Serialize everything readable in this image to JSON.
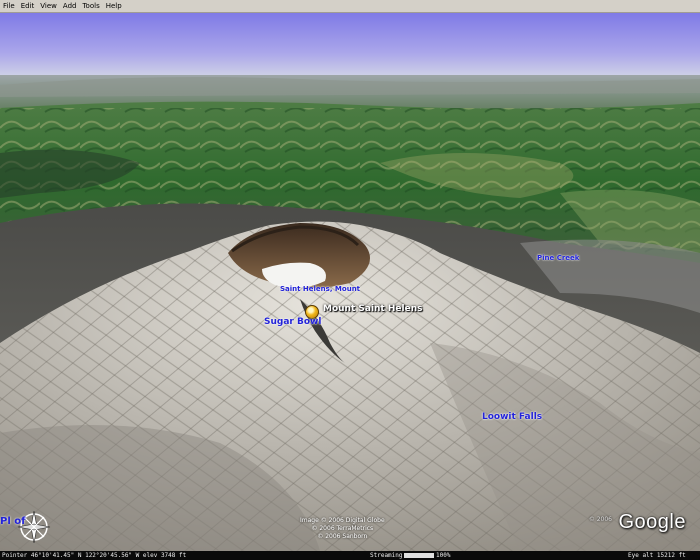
{
  "menu": [
    "File",
    "Edit",
    "View",
    "Add",
    "Tools",
    "Help"
  ],
  "labels": {
    "mount_saint_helens": "Mount Saint Helens",
    "saint_helens_mount": "Saint Helens, Mount",
    "sugar_bowl": "Sugar Bowl",
    "loowit_falls": "Loowit Falls",
    "right_small": "Pine Creek",
    "compass_overlay": "Pl        of"
  },
  "copyright": {
    "line1": "Image © 2006 Digital Globe",
    "line2": "© 2006 TerraMetrics",
    "line3": "© 2006 Sanborn"
  },
  "google": {
    "logo": "Google",
    "year": "© 2006"
  },
  "status": {
    "pointer": "Pointer  46°10'41.45\" N  122°20'45.56\" W  elev  3748 ft",
    "streaming_label": "Streaming",
    "streaming_value": "100%",
    "streaming_progress": 1.0,
    "eye_alt": "Eye  alt   15212 ft"
  },
  "icons": {
    "pin": "placemark-pin-icon",
    "compass": "compass-rose-icon"
  }
}
